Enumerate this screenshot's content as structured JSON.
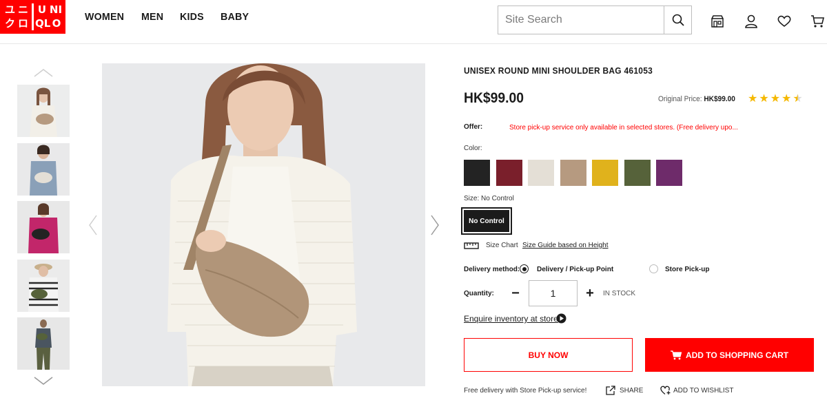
{
  "brand": {
    "logo_left": [
      "ユ",
      "ニ",
      "ク",
      "ロ"
    ],
    "logo_right": [
      "U",
      "NI",
      "QL",
      "O"
    ],
    "color": "#ff0000"
  },
  "nav": [
    "WOMEN",
    "MEN",
    "KIDS",
    "BABY"
  ],
  "search": {
    "placeholder": "Site Search",
    "icon": "search-icon"
  },
  "header_icons": [
    "store-icon",
    "account-icon",
    "wishlist-heart-icon",
    "cart-icon"
  ],
  "product": {
    "title": "UNISEX ROUND MINI SHOULDER BAG 461053",
    "price": "HK$99.00",
    "original_price_label": "Original Price:",
    "original_price": "HK$99.00",
    "rating": 4.5,
    "offer_label": "Offer:",
    "offer_text": "Store pick-up service only available in selected stores. (Free delivery upo...",
    "color_label": "Color:",
    "colors": [
      "#232323",
      "#7a1f2b",
      "#e4dfd6",
      "#b69a80",
      "#e0b21c",
      "#56623a",
      "#6e2b6a"
    ],
    "size_label": "Size: No Control",
    "size_option": "No Control",
    "size_chart": "Size Chart",
    "size_guide": "Size Guide based on Height",
    "delivery_label": "Delivery method:",
    "delivery_options": [
      "Delivery  /  Pick-up Point",
      "Store Pick-up"
    ],
    "delivery_selected": 0,
    "quantity_label": "Quantity:",
    "quantity": "1",
    "stock": "IN STOCK",
    "enquire": "Enquire inventory at store",
    "buy_now": "BUY NOW",
    "add_to_cart": "ADD TO SHOPPING CART",
    "free_delivery": "Free delivery with Store Pick-up service!",
    "share": "SHARE",
    "add_wishlist": "ADD TO WISHLIST"
  },
  "thumbnails": [
    {
      "bag": "#b69a80",
      "top": "#f0ede6",
      "bg": "#eceded"
    },
    {
      "bag": "#e4dfd6",
      "top": "#8aa0b8",
      "bg": "#e9e9ea"
    },
    {
      "bag": "#232323",
      "top": "#c2266a",
      "bg": "#e8e8e8"
    },
    {
      "bag": "#56623a",
      "top": "#f4f4f4",
      "bg": "#ebebeb"
    },
    {
      "bag": "#56623a",
      "top": "#4a5560",
      "bg": "#e7e7e7"
    }
  ]
}
